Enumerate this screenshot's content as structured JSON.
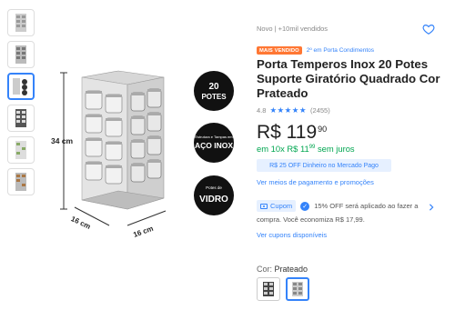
{
  "gallery": {
    "thumbs": [
      "thumb-rack-1",
      "thumb-rack-2",
      "thumb-rack-3",
      "thumb-rack-4",
      "thumb-rack-5",
      "thumb-rack-6"
    ],
    "selected": 2
  },
  "image": {
    "height_label": "34 cm",
    "width_label_1": "16 cm",
    "width_label_2": "16 cm",
    "badge1_line1": "20",
    "badge1_line2": "POTES",
    "badge2_line1": "Estrutura e Tampas em",
    "badge2_line2": "AÇO INOX",
    "badge3_line1": "Potes de",
    "badge3_line2": "VIDRO"
  },
  "product": {
    "condition": "Novo  |  +10mil vendidos",
    "best_seller": "MAIS VENDIDO",
    "rank": "2º em Porta Condimentos",
    "title": "Porta Temperos Inox 20 Potes Suporte Giratório Quadrado Cor Prateado",
    "rating_value": "4.8",
    "stars": "★★★★★",
    "reviews": "(2455)",
    "price_int": "R$ 119",
    "price_cents": "90",
    "installments_prefix": "em ",
    "installments": "10x R$ 11",
    "installments_cents": "99",
    "installments_suffix": " sem juros",
    "pix_offer": "R$ 25 OFF Dinheiro no Mercado Pago",
    "payment_link": "Ver meios de pagamento e promoções",
    "coupon_label": "Cupom",
    "coupon_text": "15% OFF será aplicado ao fazer a",
    "coupon_text2": "compra. Você economiza R$ 17,99.",
    "coupons_link": "Ver cupons disponíveis",
    "color_prefix": "Cor: ",
    "color_value": "Prateado"
  },
  "colors": {
    "accent": "#3483fa",
    "green": "#00a650",
    "orange": "#ff7733"
  }
}
